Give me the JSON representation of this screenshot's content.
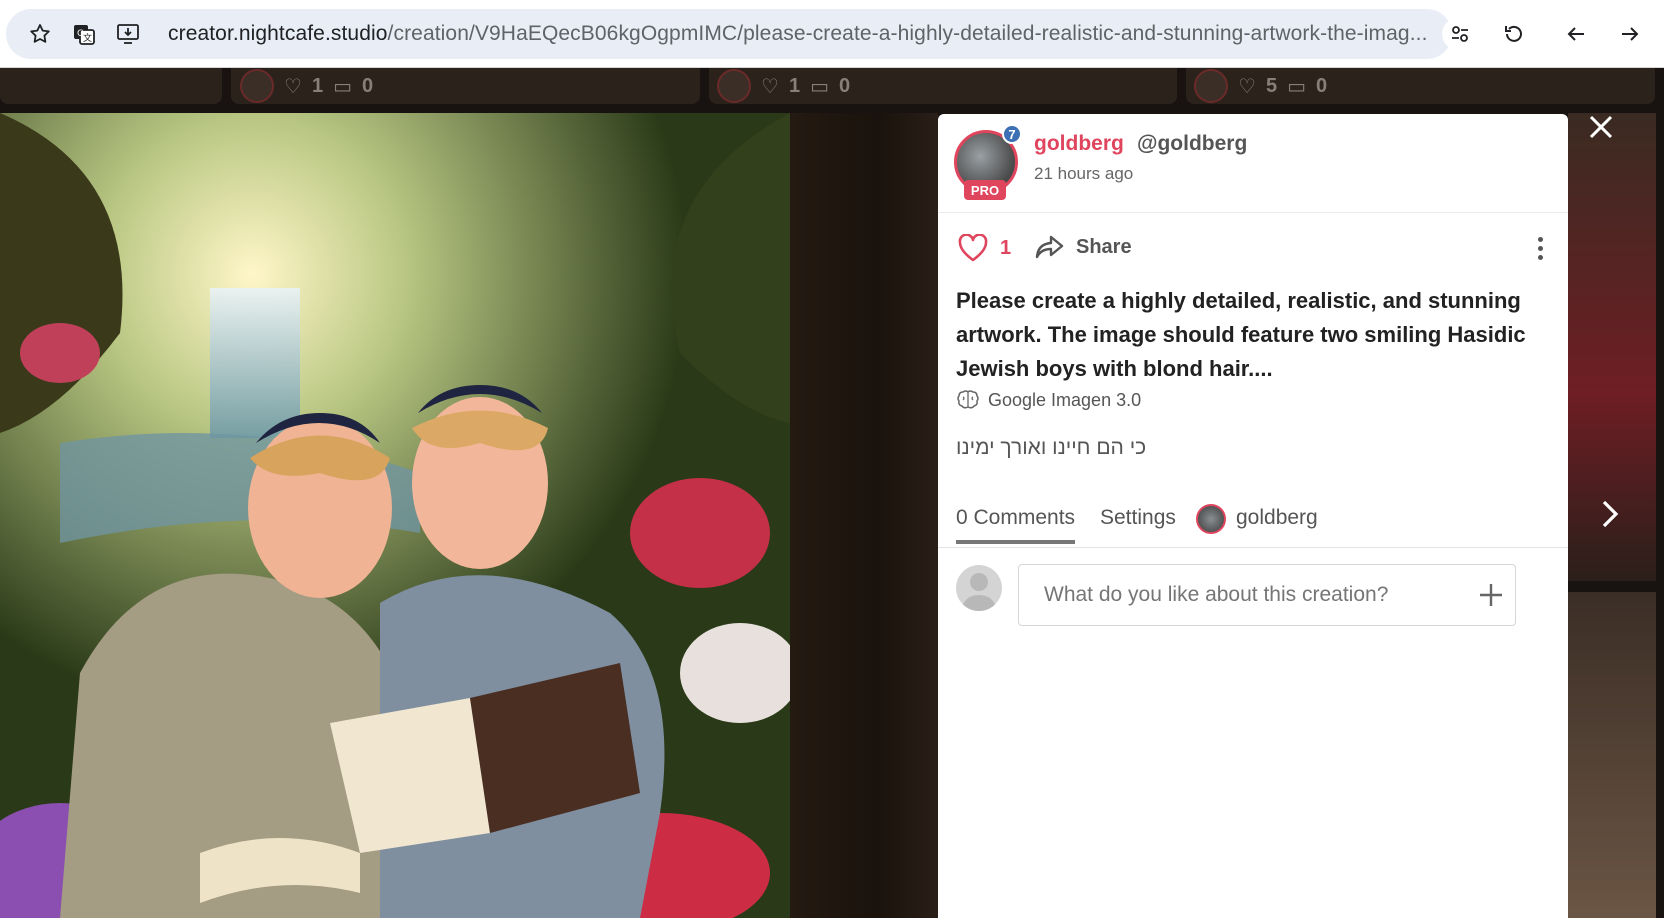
{
  "browser": {
    "url_host": "creator.nightcafe.studio",
    "url_path": "/creation/V9HaEQecB06kgOgpmIMC/please-create-a-highly-detailed-realistic-and-stunning-artwork-the-imag..."
  },
  "background_cards": [
    {
      "likes": "1",
      "comments": "0"
    },
    {
      "likes": "1",
      "comments": "0"
    },
    {
      "likes": "5",
      "comments": "0"
    }
  ],
  "creator": {
    "name": "goldberg",
    "handle": "@goldberg",
    "time_ago": "21 hours ago",
    "level_badge": "7",
    "pro_label": "PRO"
  },
  "actions": {
    "like_count": "1",
    "share_label": "Share"
  },
  "creation": {
    "prompt": "Please create a highly detailed, realistic, and stunning artwork. The image should feature two smiling Hasidic Jewish boys with blond hair....",
    "model": "Google Imagen 3.0",
    "caption": "כי הם חיינו ואורך ימינו"
  },
  "tabs": [
    {
      "label": "0 Comments",
      "active": true
    },
    {
      "label": "Settings",
      "active": false
    },
    {
      "label": "goldberg",
      "active": false
    }
  ],
  "comment": {
    "placeholder": "What do you like about this creation?"
  },
  "colors": {
    "accent": "#e0455e",
    "level_badge": "#3d6fb4"
  }
}
